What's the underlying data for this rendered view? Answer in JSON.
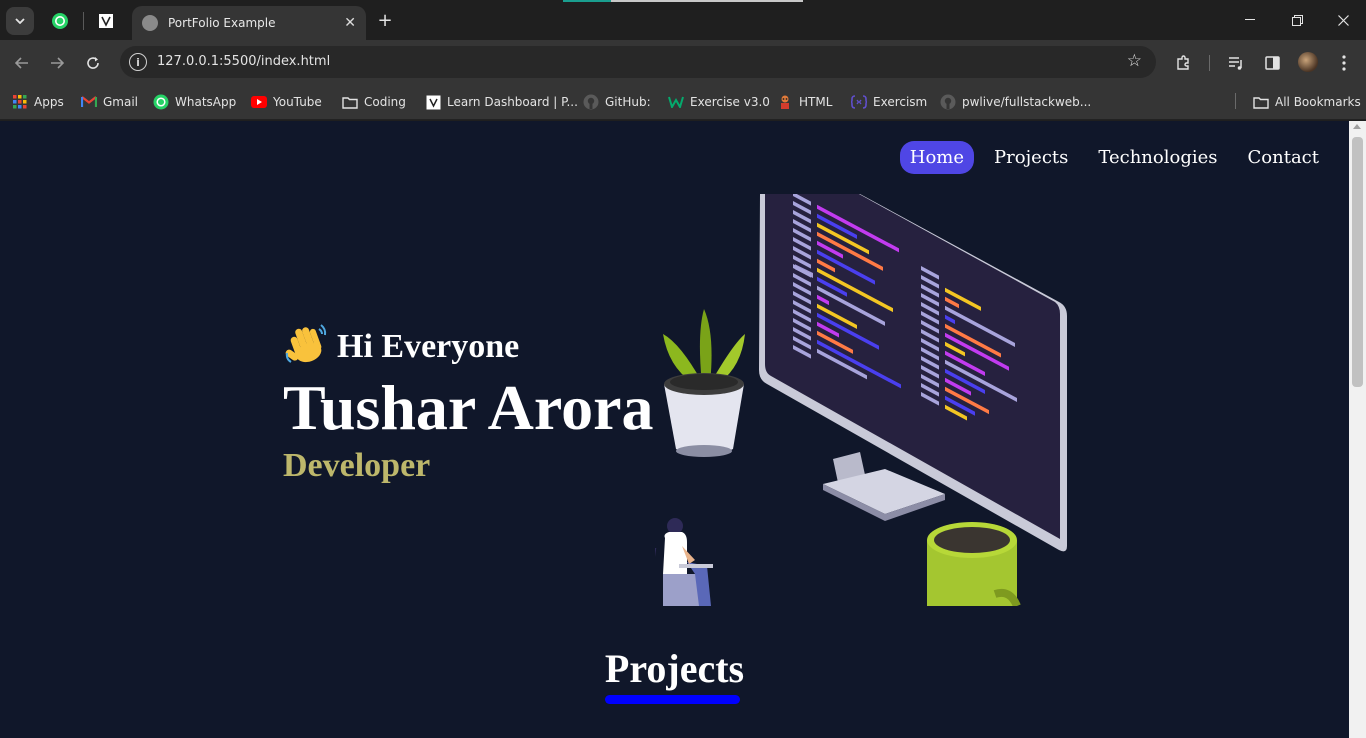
{
  "browser": {
    "tab_title": "PortFolio Example",
    "url": "127.0.0.1:5500/index.html",
    "bookmarks": [
      {
        "label": "Apps",
        "icon": "apps-grid-icon"
      },
      {
        "label": "Gmail",
        "icon": "gmail-icon"
      },
      {
        "label": "WhatsApp",
        "icon": "whatsapp-icon"
      },
      {
        "label": "YouTube",
        "icon": "youtube-icon"
      },
      {
        "label": "Coding",
        "icon": "folder-icon"
      },
      {
        "label": "Learn Dashboard | P...",
        "icon": "learn-dashboard-icon"
      },
      {
        "label": "GitHub:",
        "icon": "github-icon"
      },
      {
        "label": "Exercise v3.0",
        "icon": "exercise-icon"
      },
      {
        "label": "HTML",
        "icon": "html-bookmark-icon"
      },
      {
        "label": "Exercism",
        "icon": "exercism-icon"
      },
      {
        "label": "pwlive/fullstackweb...",
        "icon": "github-icon"
      }
    ],
    "all_bookmarks": "All Bookmarks"
  },
  "page": {
    "nav": [
      "Home",
      "Projects",
      "Technologies",
      "Contact"
    ],
    "active_nav": "Home",
    "hero": {
      "greeting": "Hi Everyone",
      "name": "Tushar Arora",
      "role": "Developer"
    },
    "projects_heading": "Projects"
  },
  "colors": {
    "page_bg": "#10172a",
    "nav_active_bg": "#4f46e5",
    "role_text": "#bdb76b",
    "projects_underline": "#0000ff"
  }
}
